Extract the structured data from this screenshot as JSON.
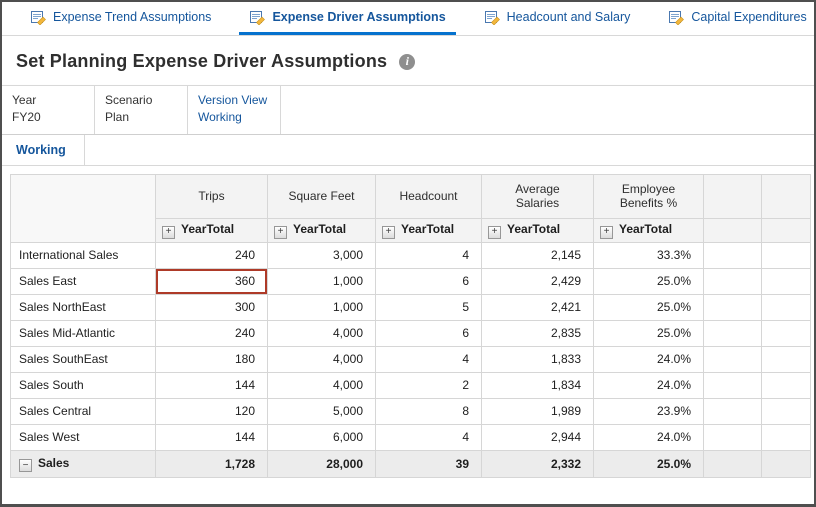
{
  "tabs": [
    {
      "label": "Expense Trend Assumptions"
    },
    {
      "label": "Expense Driver Assumptions"
    },
    {
      "label": "Headcount and Salary"
    },
    {
      "label": "Capital Expenditures"
    }
  ],
  "page_title": "Set Planning Expense Driver Assumptions",
  "pov": [
    {
      "dimension": "Year",
      "member": "FY20"
    },
    {
      "dimension": "Scenario",
      "member": "Plan"
    },
    {
      "dimension": "Version View",
      "member": "Working"
    }
  ],
  "subtab_label": "Working",
  "icons": {
    "expand": "+",
    "collapse": "−",
    "info": "i"
  },
  "grid": {
    "column_headers": [
      "Trips",
      "Square Feet",
      "Headcount",
      "Average Salaries",
      "Employee Benefits %"
    ],
    "period_label": "YearTotal",
    "rows": [
      {
        "label": "International Sales",
        "values": [
          "240",
          "3,000",
          "4",
          "2,145",
          "33.3%"
        ]
      },
      {
        "label": "Sales East",
        "values": [
          "360",
          "1,000",
          "6",
          "2,429",
          "25.0%"
        ],
        "selected_col": 0
      },
      {
        "label": "Sales NorthEast",
        "values": [
          "300",
          "1,000",
          "5",
          "2,421",
          "25.0%"
        ]
      },
      {
        "label": "Sales Mid-Atlantic",
        "values": [
          "240",
          "4,000",
          "6",
          "2,835",
          "25.0%"
        ]
      },
      {
        "label": "Sales SouthEast",
        "values": [
          "180",
          "4,000",
          "4",
          "1,833",
          "24.0%"
        ]
      },
      {
        "label": "Sales South",
        "values": [
          "144",
          "4,000",
          "2",
          "1,834",
          "24.0%"
        ]
      },
      {
        "label": "Sales Central",
        "values": [
          "120",
          "5,000",
          "8",
          "1,989",
          "23.9%"
        ]
      },
      {
        "label": "Sales West",
        "values": [
          "144",
          "6,000",
          "4",
          "2,944",
          "24.0%"
        ]
      }
    ],
    "total_row": {
      "label": "Sales",
      "values": [
        "1,728",
        "28,000",
        "39",
        "2,332",
        "25.0%"
      ]
    }
  }
}
